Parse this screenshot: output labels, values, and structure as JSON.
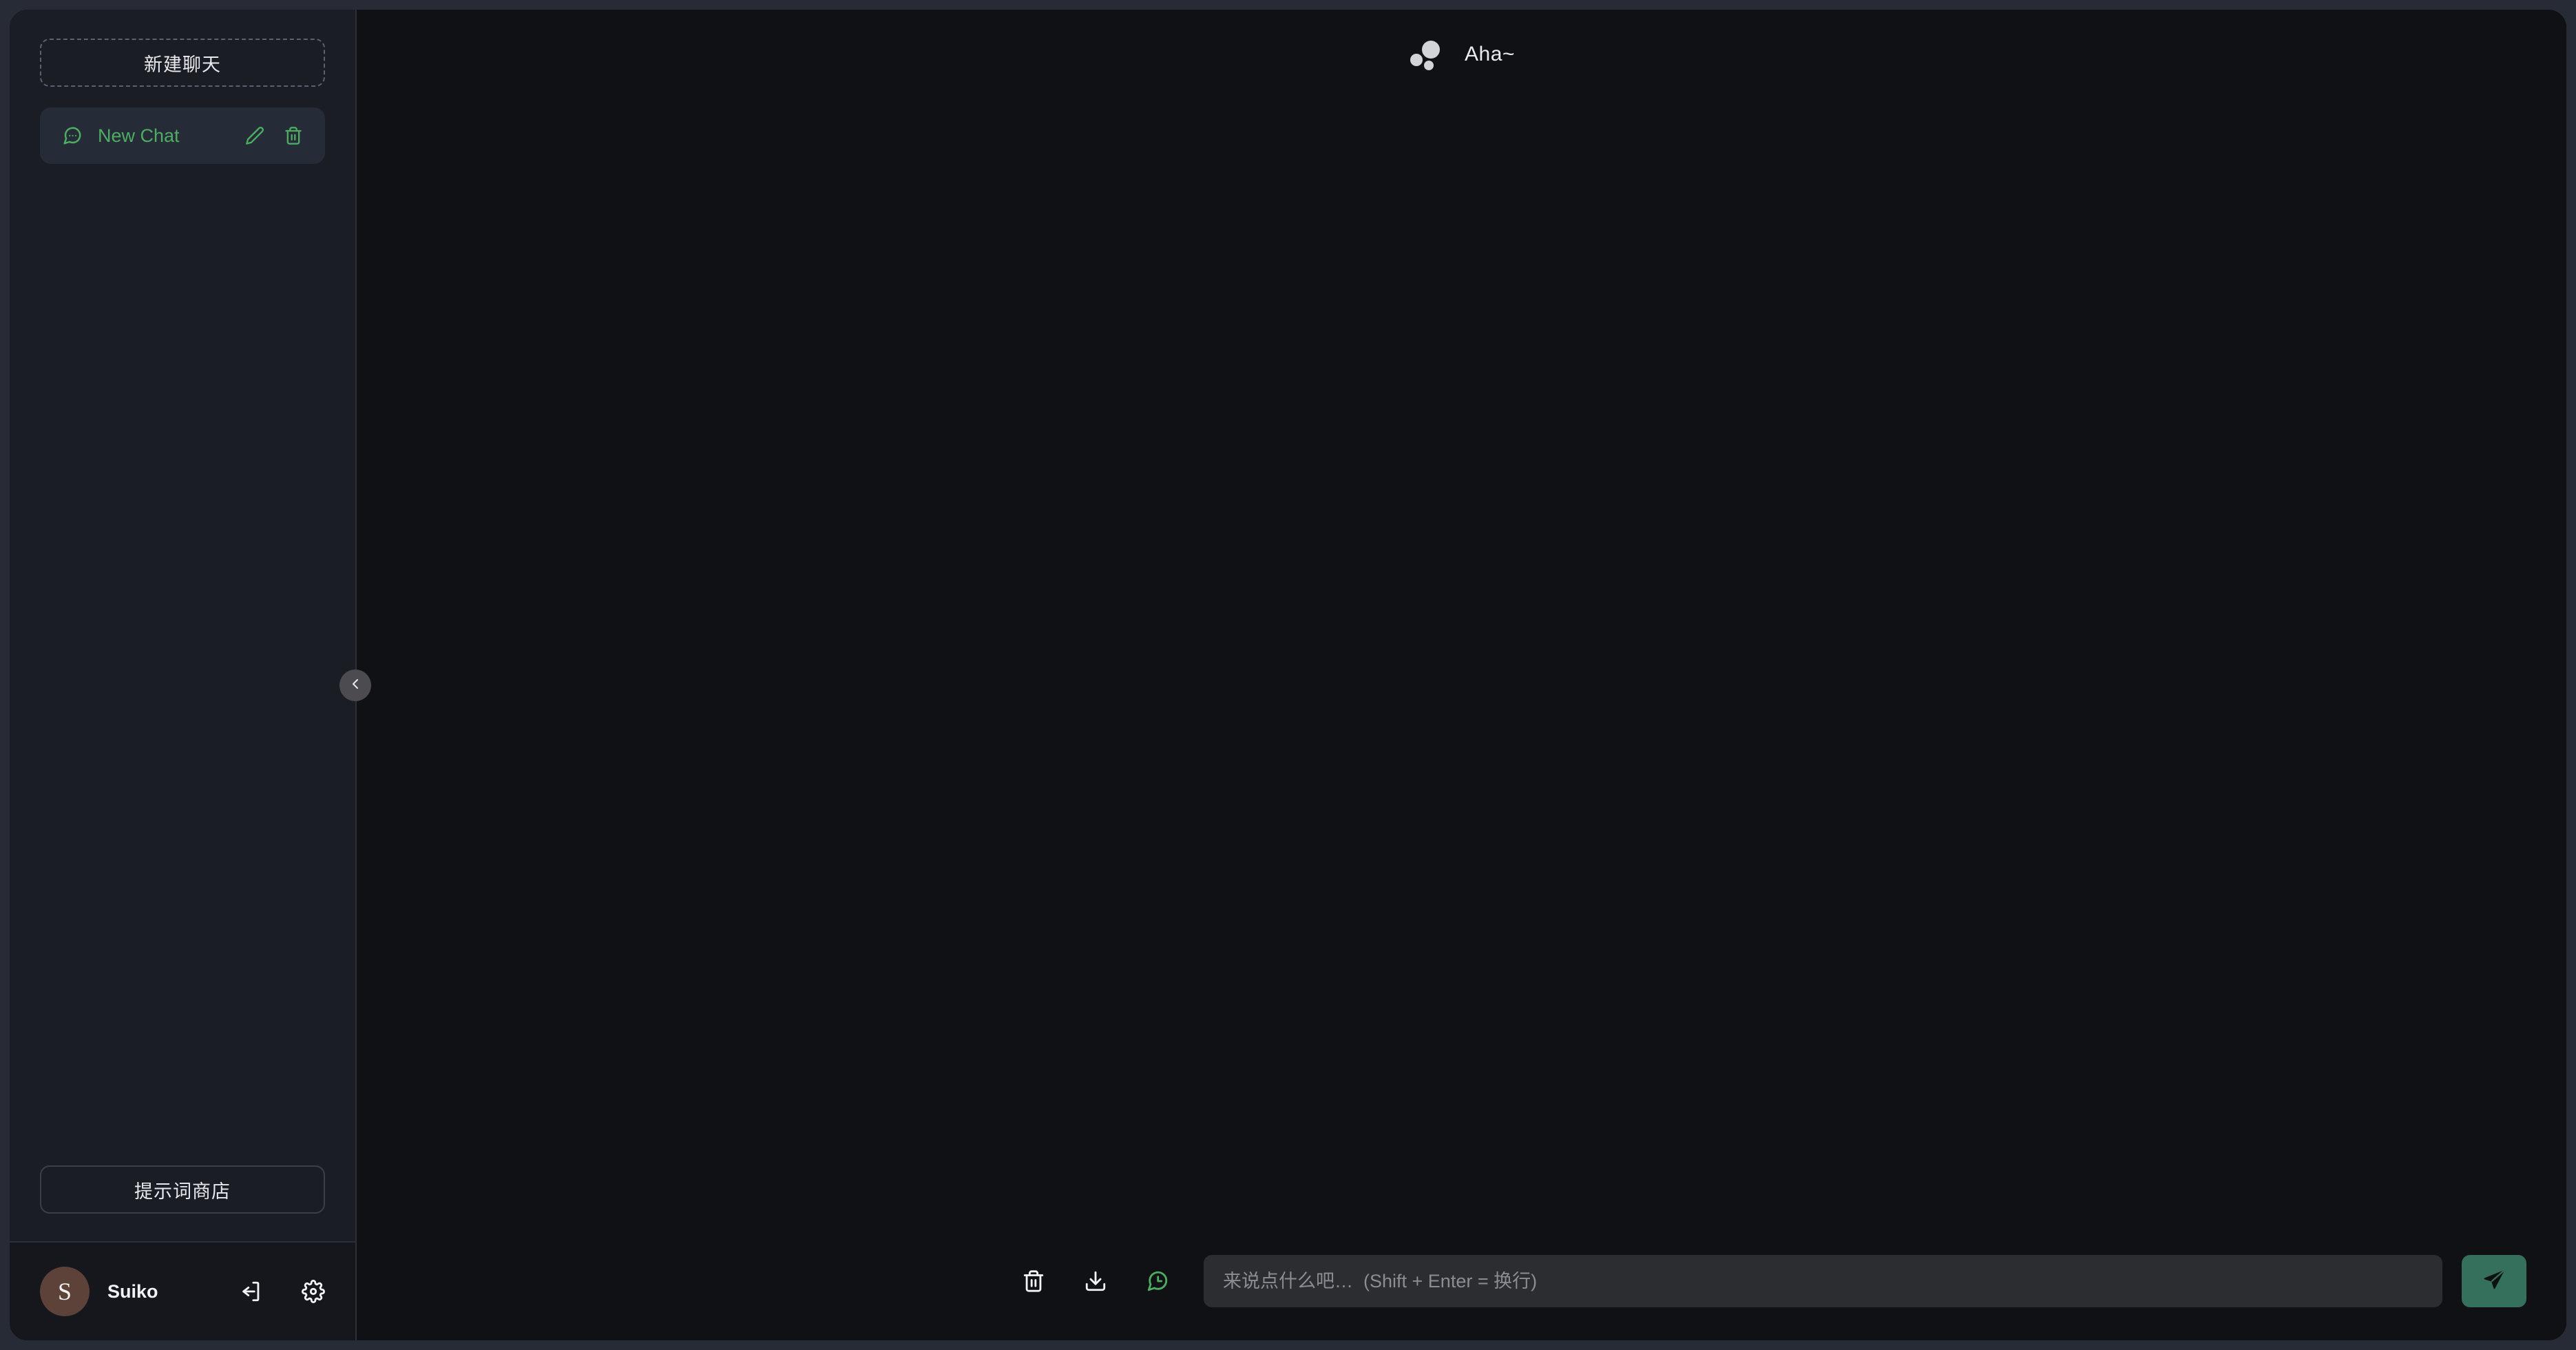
{
  "theme": {
    "page_background": "#262b35",
    "sidebar_background": "#1b1d24",
    "main_background": "#101114",
    "accent_green": "#4eac63",
    "send_button_color": "#35705c",
    "avatar_color": "#5d4239",
    "input_background": "#2c2d30",
    "active_item_background": "#262c37"
  },
  "sidebar": {
    "new_chat_label": "新建聊天",
    "prompt_store_label": "提示词商店",
    "chats": [
      {
        "title": "New Chat",
        "icon": "message-square-icon",
        "active": true,
        "edit_icon": "pencil-icon",
        "delete_icon": "trash-icon"
      }
    ],
    "collapse_toggle_icon": "chevron-left-icon",
    "user": {
      "avatar_initial": "S",
      "name": "Suiko",
      "logout_icon": "logout-icon",
      "settings_icon": "gear-icon"
    }
  },
  "main": {
    "header": {
      "logo_icon": "three-dots-logo",
      "title": "Aha~"
    },
    "messages": [],
    "composer": {
      "tools": [
        {
          "icon": "trash-icon",
          "name": "clear-conversation"
        },
        {
          "icon": "download-icon",
          "name": "export-conversation"
        },
        {
          "icon": "chat-history-clock-icon",
          "name": "chat-history"
        }
      ],
      "input_value": "",
      "input_placeholder": "来说点什么吧…  (Shift + Enter = 换行)",
      "send_icon": "send-plane-icon"
    }
  }
}
